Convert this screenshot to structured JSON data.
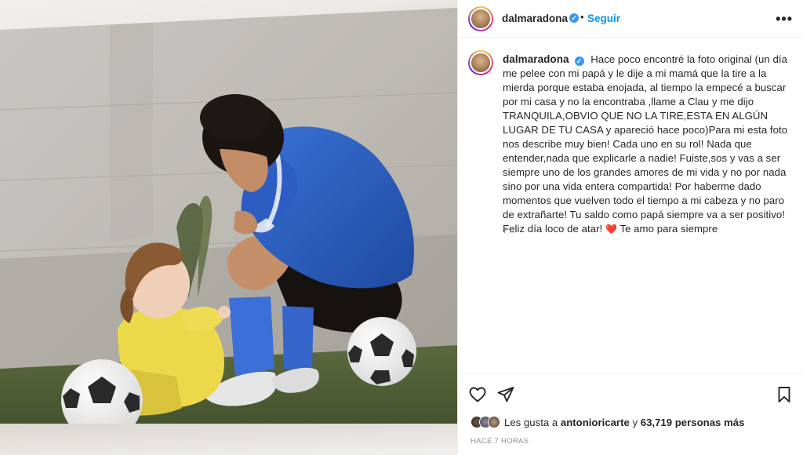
{
  "post": {
    "username": "dalmaradona",
    "verified_mark": "✓",
    "separator": "•",
    "follow_label": "Seguir",
    "more_icon": "more-dots-icon",
    "more_label": "•••"
  },
  "caption": {
    "username": "dalmaradona",
    "text": "Hace poco encontré la foto original (un día me pelee con mi papá y le dije a mi mamá que la tire a la mierda porque estaba enojada, al tiempo la empecé a buscar por mi casa y no la encontraba ,llame a Clau y me dijo TRANQUILA,OBVIO QUE NO LA TIRE,ESTA EN ALGÚN LUGAR DE TU CASA y apareció hace poco)Para mi esta foto nos describe muy bien! Cada uno en su rol! Nada que entender,nada que explicarle a nadie! Fuiste,sos y vas a ser siempre uno de los grandes amores de mi vida y no por nada sino por una vida entera compartida! Por haberme dado momentos que vuelven todo el tiempo a mi cabeza y no paro de extrañarte! Tu saldo como papá siempre va a ser positivo! Feliz día loco de atar!",
    "heart": "❤️",
    "tail": "Te amo para siempre",
    "time_ago": "7 h"
  },
  "actions": {
    "like_icon": "heart-outline-icon",
    "share_icon": "send-icon",
    "save_icon": "bookmark-icon"
  },
  "likes": {
    "prefix": "Les gusta a",
    "liker": "antonioricarte",
    "conjunction": "y",
    "count": "63,719 personas más"
  },
  "timestamp": "HACE 7 HORAS",
  "colors": {
    "accent": "#0095f6",
    "verified": "#3897f0",
    "text": "#262626",
    "muted": "#8e8e8e",
    "jersey": "#2a5fc0"
  }
}
